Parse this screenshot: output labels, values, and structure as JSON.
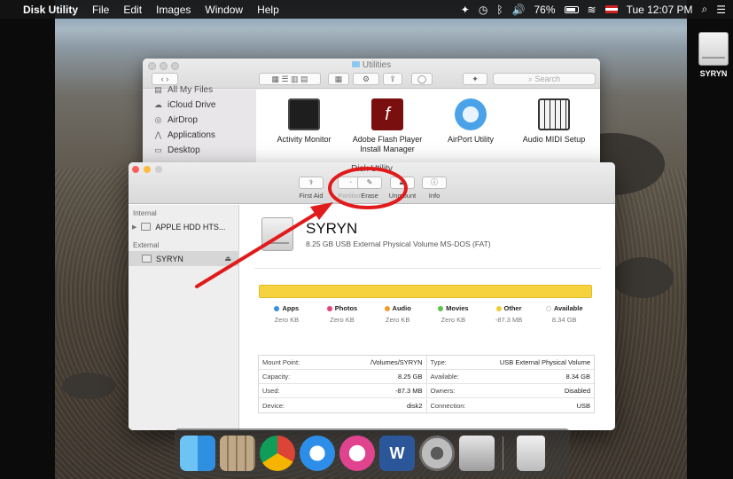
{
  "menubar": {
    "app": "Disk Utility",
    "items": [
      "File",
      "Edit",
      "Images",
      "Window",
      "Help"
    ],
    "battery": "76%",
    "clock": "Tue 12:07 PM"
  },
  "desktop": {
    "drive_label": "SYRYN"
  },
  "finder": {
    "title": "Utilities",
    "search_placeholder": "Search",
    "sidebar": [
      "All My Files",
      "iCloud Drive",
      "AirDrop",
      "Applications",
      "Desktop"
    ],
    "apps": [
      {
        "name": "Activity Monitor"
      },
      {
        "name": "Adobe Flash Player Install Manager"
      },
      {
        "name": "AirPort Utility"
      },
      {
        "name": "Audio MIDI Setup"
      }
    ]
  },
  "disk_utility": {
    "title": "Disk Utility",
    "toolbar": [
      "First Aid",
      "Partition",
      "Erase",
      "Unmount",
      "Info"
    ],
    "sidebar": {
      "internal_heading": "Internal",
      "internal_disk": "APPLE HDD HTS...",
      "external_heading": "External",
      "external_disk": "SYRYN"
    },
    "volume": {
      "name": "SYRYN",
      "description": "8.25 GB USB External Physical Volume MS-DOS (FAT)"
    },
    "legend": [
      {
        "label": "Apps",
        "value": "Zero KB",
        "color": "#3a8ee6"
      },
      {
        "label": "Photos",
        "value": "Zero KB",
        "color": "#e8407f"
      },
      {
        "label": "Audio",
        "value": "Zero KB",
        "color": "#f29b2b"
      },
      {
        "label": "Movies",
        "value": "Zero KB",
        "color": "#5cc24a"
      },
      {
        "label": "Other",
        "value": "-87.3 MB",
        "color": "#f2cc33"
      },
      {
        "label": "Available",
        "value": "8.34 GB",
        "color": "#ffffff"
      }
    ],
    "info": [
      {
        "k1": "Mount Point:",
        "v1": "/Volumes/SYRYN",
        "k2": "Type:",
        "v2": "USB External Physical Volume"
      },
      {
        "k1": "Capacity:",
        "v1": "8.25 GB",
        "k2": "Available:",
        "v2": "8.34 GB"
      },
      {
        "k1": "Used:",
        "v1": "-87.3 MB",
        "k2": "Owners:",
        "v2": "Disabled"
      },
      {
        "k1": "Device:",
        "v1": "disk2",
        "k2": "Connection:",
        "v2": "USB"
      }
    ]
  },
  "dock": [
    "Finder",
    "Calculator",
    "Chrome",
    "Safari",
    "iTunes",
    "Word",
    "System Preferences",
    "Disk Utility",
    "Trash"
  ]
}
